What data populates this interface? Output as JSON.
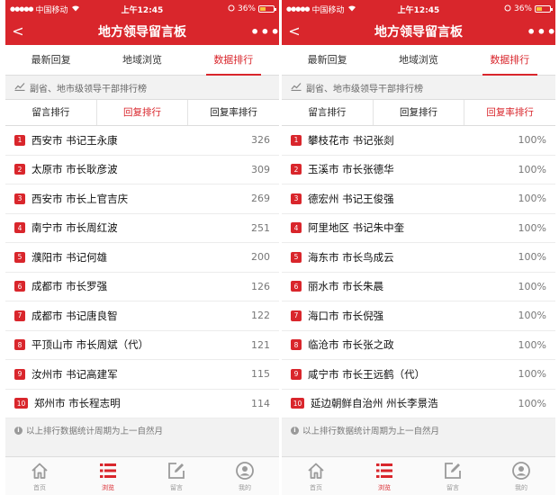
{
  "screens": [
    {
      "status": {
        "carrier": "中国移动",
        "time": "上午12:45",
        "battery": "36%"
      },
      "nav": {
        "back": "<",
        "title": "地方领导留言板",
        "more": "•••"
      },
      "tabs": [
        {
          "label": "最新回复"
        },
        {
          "label": "地域浏览"
        },
        {
          "label": "数据排行"
        }
      ],
      "active_tab": 2,
      "section_title": "副省、地市级领导干部排行榜",
      "subtabs": [
        {
          "label": "留言排行"
        },
        {
          "label": "回复排行"
        },
        {
          "label": "回复率排行"
        }
      ],
      "active_subtab": 1,
      "rows": [
        {
          "rank": "1",
          "name": "西安市 书记王永康",
          "value": "326"
        },
        {
          "rank": "2",
          "name": "太原市 市长耿彦波",
          "value": "309"
        },
        {
          "rank": "3",
          "name": "西安市 市长上官吉庆",
          "value": "269"
        },
        {
          "rank": "4",
          "name": "南宁市 市长周红波",
          "value": "251"
        },
        {
          "rank": "5",
          "name": "濮阳市 书记何雄",
          "value": "200"
        },
        {
          "rank": "6",
          "name": "成都市 市长罗强",
          "value": "126"
        },
        {
          "rank": "7",
          "name": "成都市 书记唐良智",
          "value": "122"
        },
        {
          "rank": "8",
          "name": "平顶山市 市长周斌（代）",
          "value": "121"
        },
        {
          "rank": "9",
          "name": "汝州市 书记高建军",
          "value": "115"
        },
        {
          "rank": "10",
          "name": "郑州市 市长程志明",
          "value": "114"
        }
      ],
      "footnote": "以上排行数据统计周期为上一自然月",
      "tabbar": [
        {
          "label": "首页",
          "icon": "home-icon"
        },
        {
          "label": "浏览",
          "icon": "list-icon"
        },
        {
          "label": "留言",
          "icon": "edit-icon"
        },
        {
          "label": "我的",
          "icon": "user-icon"
        }
      ],
      "active_tabbar": 1
    },
    {
      "status": {
        "carrier": "中国移动",
        "time": "上午12:45",
        "battery": "36%"
      },
      "nav": {
        "back": "<",
        "title": "地方领导留言板",
        "more": "•••"
      },
      "tabs": [
        {
          "label": "最新回复"
        },
        {
          "label": "地域浏览"
        },
        {
          "label": "数据排行"
        }
      ],
      "active_tab": 2,
      "section_title": "副省、地市级领导干部排行榜",
      "subtabs": [
        {
          "label": "留言排行"
        },
        {
          "label": "回复排行"
        },
        {
          "label": "回复率排行"
        }
      ],
      "active_subtab": 2,
      "rows": [
        {
          "rank": "1",
          "name": "攀枝花市 书记张剡",
          "value": "100%"
        },
        {
          "rank": "2",
          "name": "玉溪市 市长张德华",
          "value": "100%"
        },
        {
          "rank": "3",
          "name": "德宏州 书记王俊强",
          "value": "100%"
        },
        {
          "rank": "4",
          "name": "阿里地区 书记朱中奎",
          "value": "100%"
        },
        {
          "rank": "5",
          "name": "海东市 市长鸟成云",
          "value": "100%"
        },
        {
          "rank": "6",
          "name": "丽水市 市长朱晨",
          "value": "100%"
        },
        {
          "rank": "7",
          "name": "海口市 市长倪强",
          "value": "100%"
        },
        {
          "rank": "8",
          "name": "临沧市 市长张之政",
          "value": "100%"
        },
        {
          "rank": "9",
          "name": "咸宁市 市长王远鹤（代）",
          "value": "100%"
        },
        {
          "rank": "10",
          "name": "延边朝鲜自治州 州长李景浩",
          "value": "100%"
        }
      ],
      "footnote": "以上排行数据统计周期为上一自然月",
      "tabbar": [
        {
          "label": "首页",
          "icon": "home-icon"
        },
        {
          "label": "浏览",
          "icon": "list-icon"
        },
        {
          "label": "留言",
          "icon": "edit-icon"
        },
        {
          "label": "我的",
          "icon": "user-icon"
        }
      ],
      "active_tabbar": 1
    }
  ],
  "colors": {
    "accent": "#d9262c",
    "muted": "#9a9a9a",
    "background": "#f2f2f2"
  }
}
